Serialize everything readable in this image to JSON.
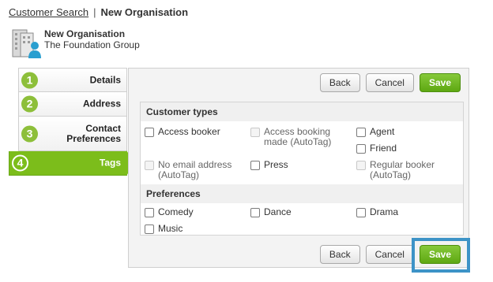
{
  "breadcrumb": {
    "link": "Customer Search",
    "separator": "|",
    "current": "New Organisation"
  },
  "org": {
    "name": "New Organisation",
    "subtitle": "The Foundation Group",
    "icon": "building-person-icon"
  },
  "tabs": [
    {
      "number": "1",
      "label": "Details"
    },
    {
      "number": "2",
      "label": "Address"
    },
    {
      "number": "3",
      "label": "Contact Preferences"
    },
    {
      "number": "4",
      "label": "Tags"
    }
  ],
  "toolbar": {
    "back": "Back",
    "cancel": "Cancel",
    "save": "Save"
  },
  "customer_types": {
    "heading": "Customer types",
    "options": [
      {
        "label": "Access booker",
        "checked": false,
        "disabled": false
      },
      {
        "label": "Access booking made (AutoTag)",
        "checked": false,
        "disabled": true
      },
      {
        "label": "Agent",
        "checked": false,
        "disabled": false
      },
      {
        "label": "Friend",
        "checked": false,
        "disabled": false
      },
      {
        "label": "No email address (AutoTag)",
        "checked": false,
        "disabled": true
      },
      {
        "label": "Press",
        "checked": false,
        "disabled": false
      },
      {
        "label": "Regular booker (AutoTag)",
        "checked": false,
        "disabled": true
      }
    ]
  },
  "preferences": {
    "heading": "Preferences",
    "options": [
      {
        "label": "Comedy",
        "checked": false
      },
      {
        "label": "Dance",
        "checked": false
      },
      {
        "label": "Drama",
        "checked": false
      },
      {
        "label": "Music",
        "checked": false
      }
    ]
  },
  "colors": {
    "accent_green": "#7cbd1b",
    "highlight_blue": "#3d93c7"
  }
}
